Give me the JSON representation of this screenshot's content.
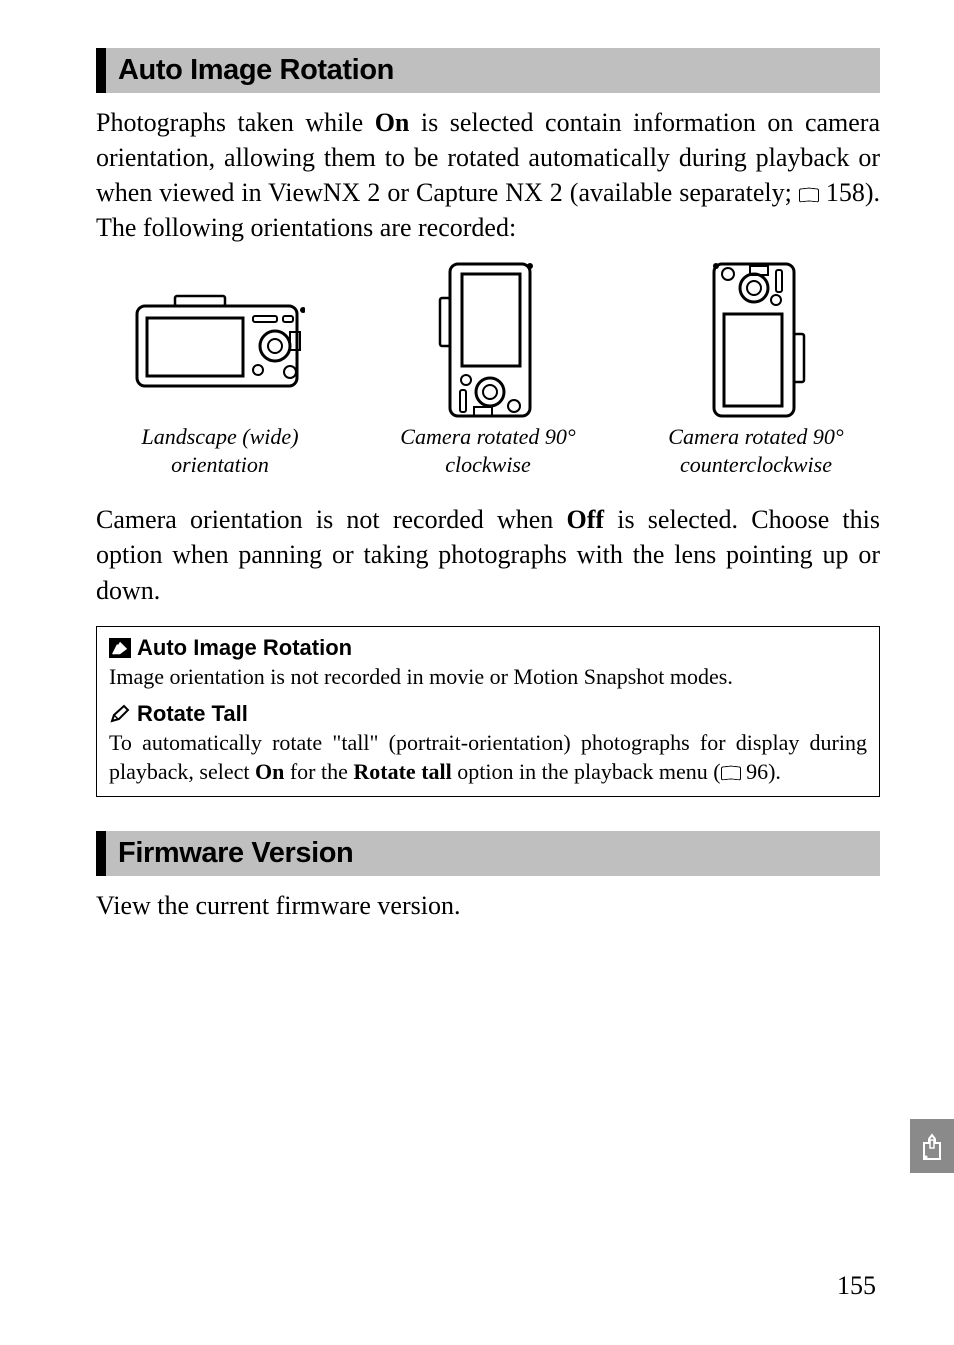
{
  "section1_header": "Auto Image Rotation",
  "para1_a": "Photographs taken while ",
  "para1_on": "On",
  "para1_b": " is selected contain information on camera orientation, allowing them to be rotated automatically during playback or when viewed in ViewNX 2 or Capture NX 2 (available separately; ",
  "para1_ref": "158",
  "para1_c": "). The following orientations are recorded:",
  "orient1": "Landscape (wide) orientation",
  "orient2": "Camera rotated 90° clockwise",
  "orient3": "Camera rotated 90° counterclockwise",
  "para2_a": "Camera orientation is not recorded when ",
  "para2_off": "Off",
  "para2_b": " is selected. Choose this option when panning or taking photographs with the lens pointing up or down.",
  "note1_title": "Auto Image Rotation",
  "note1_body": "Image orientation is not recorded in movie or Motion Snapshot modes.",
  "note2_title": "Rotate Tall",
  "note2_a": "To automatically rotate \"tall\" (portrait-orientation) photographs for display during playback, select ",
  "note2_on": "On",
  "note2_b": " for the ",
  "note2_rt": "Rotate tall",
  "note2_c": " option in the playback menu (",
  "note2_ref": "96",
  "note2_d": ").",
  "section2_header": "Firmware Version",
  "para3": "View the current firmware version.",
  "page_num": "155"
}
